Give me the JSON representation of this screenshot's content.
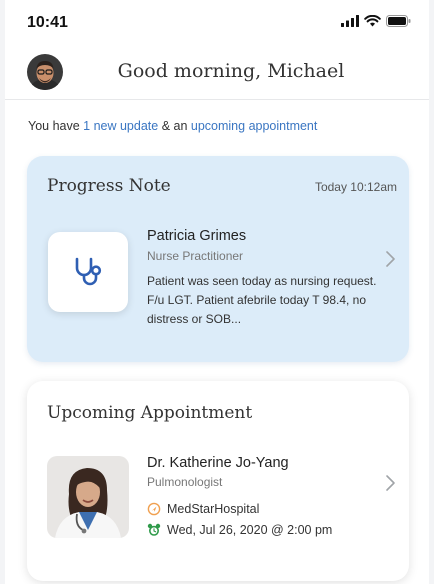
{
  "status": {
    "time": "10:41"
  },
  "header": {
    "greeting": "Good morning, Michael"
  },
  "update_line": {
    "prefix": "You have ",
    "updates_link": "1 new update",
    "middle": " & an ",
    "appointment_link": "upcoming appointment"
  },
  "progress_note": {
    "title": "Progress Note",
    "timestamp": "Today 10:12am",
    "author_name": "Patricia Grimes",
    "author_role": "Nurse Practitioner",
    "note": "Patient was seen today as nursing request. F/u LGT. Patient afebrile today T 98.4, no distress or SOB..."
  },
  "appointment": {
    "title": "Upcoming Appointment",
    "doctor_name": "Dr. Katherine Jo-Yang",
    "specialty": "Pulmonologist",
    "location": "MedStarHospital",
    "datetime": "Wed, Jul 26, 2020 @ 2:00 pm"
  },
  "colors": {
    "accent": "#3a76c2",
    "progress_card_bg": "#dcecf9",
    "location_icon": "#f0a050",
    "alarm_icon": "#2f9a4a"
  },
  "icons": {
    "signal": "signal-icon",
    "wifi": "wifi-icon",
    "battery": "battery-icon",
    "stethoscope": "stethoscope-icon",
    "chevron": "chevron-right-icon",
    "location": "location-icon",
    "alarm": "alarm-clock-icon"
  }
}
